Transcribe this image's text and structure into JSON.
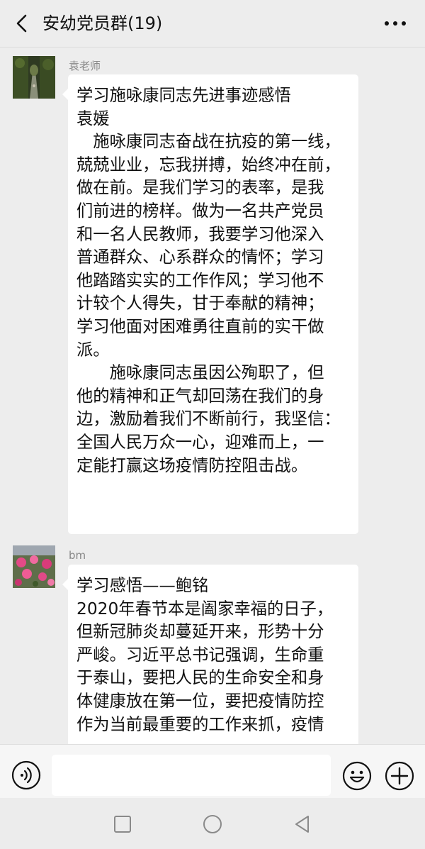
{
  "header": {
    "title": "安幼党员群(19)"
  },
  "messages": [
    {
      "sender": "袁老师",
      "avatar": "avatar-garden-path-photo",
      "lines": [
        "学习施咏康同志先进事迹感悟",
        "袁媛",
        "　施咏康同志奋战在抗疫的第一线，",
        "兢兢业业，忘我拼搏，始终冲在前，",
        "做在前。是我们学习的表率，是我",
        "们前进的榜样。做为一名共产党员",
        "和一名人民教师，我要学习他深入",
        "普通群众、心系群众的情怀；学习",
        "他踏踏实实的工作作风；学习他不",
        "计较个人得失，甘于奉献的精神；",
        "学习他面对困难勇往直前的实干做",
        "派。",
        "　　施咏康同志虽因公殉职了，但",
        "他的精神和正气却回荡在我们的身",
        "边，激励着我们不断前行，我坚信：",
        "全国人民万众一心，迎难而上，一",
        "定能打赢这场疫情防控阻击战。"
      ]
    },
    {
      "sender": "bm",
      "avatar": "avatar-pink-flowers-photo",
      "lines": [
        "学习感悟——鲍铭",
        "2020年春节本是阖家幸福的日子，",
        "但新冠肺炎却蔓延开来，形势十分",
        "严峻。习近平总书记强调，生命重",
        "于泰山，要把人民的生命安全和身",
        "体健康放在第一位，要把疫情防控",
        "作为当前最重要的工作来抓，疫情"
      ]
    }
  ],
  "input_bar": {
    "value": "",
    "placeholder": ""
  },
  "icons": {
    "back": "chevron-left-icon",
    "more": "more-dots-icon",
    "voice": "voice-icon",
    "emoji": "emoji-icon",
    "plus": "plus-icon",
    "recent": "square-icon",
    "home": "circle-icon",
    "nav_back": "triangle-back-icon"
  },
  "colors": {
    "background": "#ededed",
    "bubble": "#ffffff",
    "sender": "#888888",
    "icon": "#111111"
  }
}
